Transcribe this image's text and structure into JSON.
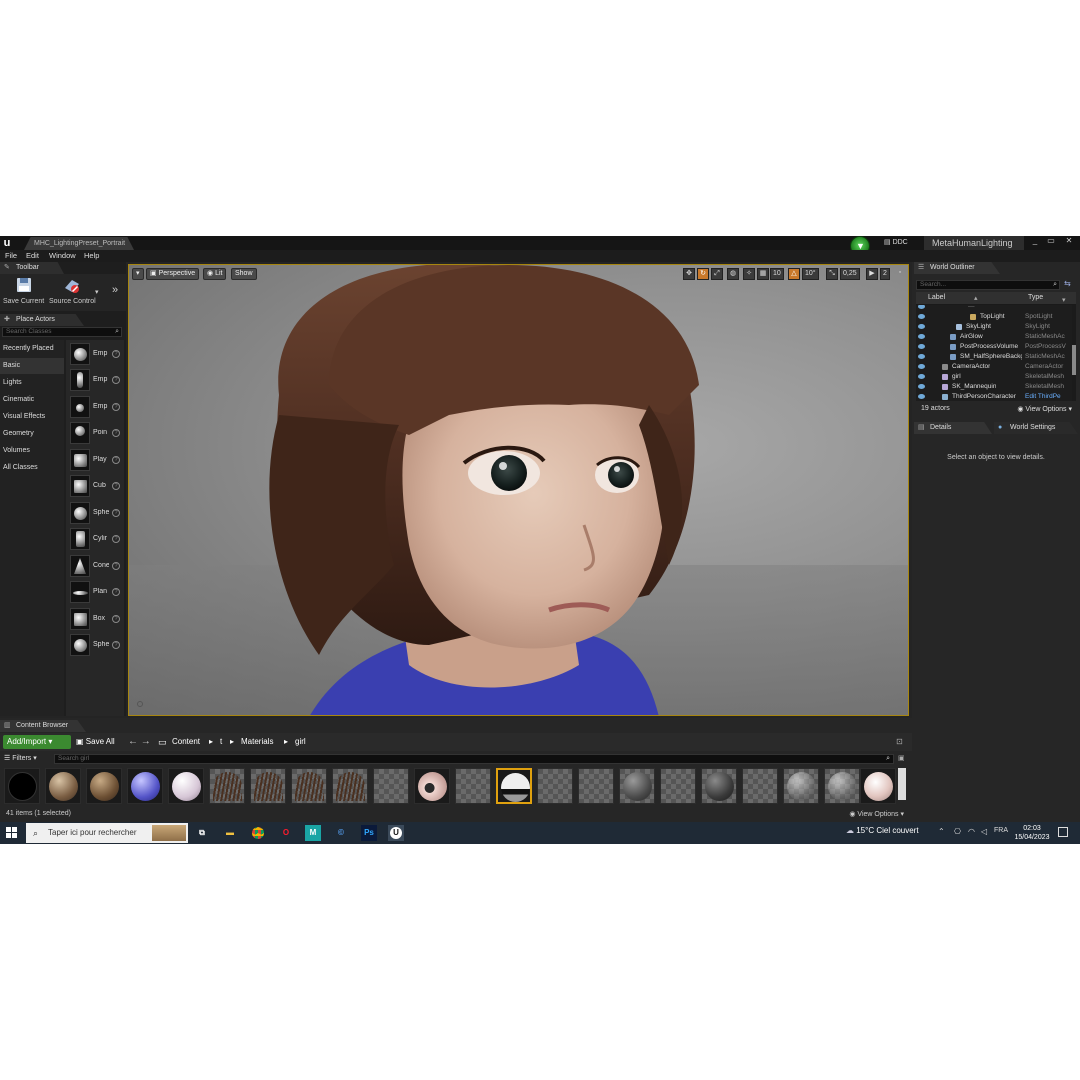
{
  "window": {
    "logo": "u",
    "doc_tab": "MHC_LightingPreset_Portrait",
    "ddc_label": "DDC",
    "project_name": "MetaHumanLighting",
    "controls": [
      "_",
      "▭",
      "✕"
    ]
  },
  "menu": [
    "File",
    "Edit",
    "Window",
    "Help"
  ],
  "toolbar": {
    "tab_label": "Toolbar",
    "save_current": "Save Current",
    "source_control": "Source Control"
  },
  "place_actors": {
    "tab_label": "Place Actors",
    "search_placeholder": "Search Classes",
    "categories": [
      "Recently Placed",
      "Basic",
      "Lights",
      "Cinematic",
      "Visual Effects",
      "Geometry",
      "Volumes",
      "All Classes"
    ],
    "actors": [
      "Emp",
      "Emp",
      "Emp",
      "Poin",
      "Play",
      "Cub",
      "Sphe",
      "Cylir",
      "Cone",
      "Plan",
      "Box",
      "Sphe"
    ]
  },
  "viewport": {
    "perspective": "Perspective",
    "lit": "Lit",
    "show": "Show",
    "grid_value": "10",
    "rotation_value": "10°",
    "scale_value": "0,25",
    "camera_speed": "2"
  },
  "world_outliner": {
    "tab_label": "World Outliner",
    "search_placeholder": "Search...",
    "col_label": "Label",
    "col_type": "Type",
    "rows": [
      {
        "label": "TopLight",
        "type": "SpotLight"
      },
      {
        "label": "SkyLight",
        "type": "SkyLight"
      },
      {
        "label": "AirGlow",
        "type": "StaticMeshAc"
      },
      {
        "label": "PostProcessVolume",
        "type": "PostProcessV"
      },
      {
        "label": "SM_HalfSphereBackg",
        "type": "StaticMeshAc"
      },
      {
        "label": "CameraActor",
        "type": "CameraActor"
      },
      {
        "label": "girl",
        "type": "SkeletalMesh"
      },
      {
        "label": "SK_Mannequin",
        "type": "SkeletalMesh"
      },
      {
        "label": "ThirdPersonCharacter",
        "type": "Edit ThirdPe"
      }
    ],
    "count": "19 actors",
    "view_options": "View Options"
  },
  "details": {
    "tab_label": "Details",
    "world_settings": "World Settings",
    "empty_message": "Select an object to view details."
  },
  "content_browser": {
    "tab_label": "Content Browser",
    "add_import": "Add/Import",
    "save_all": "Save All",
    "breadcrumb": [
      "Content",
      "t",
      "Materials",
      "girl"
    ],
    "filters": "Filters",
    "search_placeholder": "Search girl",
    "status": "41 items (1 selected)",
    "view_options": "View Options"
  },
  "taskbar": {
    "search_placeholder": "Taper ici pour rechercher",
    "weather": "15°C  Ciel couvert",
    "language": "FRA",
    "time": "02:03",
    "date": "15/04/2023"
  },
  "colors": {
    "accent_selection": "#e0a10f",
    "add_import_green": "#3b8a30",
    "viewport_border": "#a7860f"
  }
}
